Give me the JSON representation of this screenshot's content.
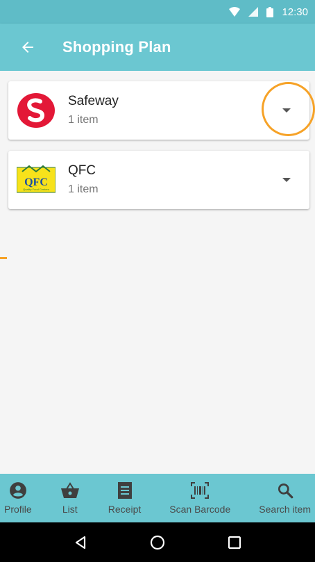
{
  "status_bar": {
    "time": "12:30",
    "icons": [
      "wifi-icon",
      "signal-icon",
      "battery-icon"
    ]
  },
  "app_bar": {
    "title": "Shopping Plan",
    "back_icon": "arrow-back-icon"
  },
  "stores": [
    {
      "name": "Safeway",
      "count": "1 item",
      "logo": "safeway-logo",
      "expand_icon": "chevron-down-icon"
    },
    {
      "name": "QFC",
      "count": "1 item",
      "logo": "qfc-logo",
      "logo_text": "QFC",
      "logo_tagline": "Quality Food Centers",
      "expand_icon": "chevron-down-icon"
    }
  ],
  "bottom_nav": [
    {
      "label": "Profile",
      "icon": "account-circle-icon"
    },
    {
      "label": "List",
      "icon": "basket-icon"
    },
    {
      "label": "Receipt",
      "icon": "receipt-icon"
    },
    {
      "label": "Scan Barcode",
      "icon": "barcode-scan-icon"
    },
    {
      "label": "Search item",
      "icon": "search-icon"
    }
  ],
  "colors": {
    "primary": "#6bc7d1",
    "status_bar": "#5fbcc7",
    "highlight": "#f6a227",
    "safeway_red": "#e31837",
    "qfc_yellow": "#f7e21b"
  }
}
